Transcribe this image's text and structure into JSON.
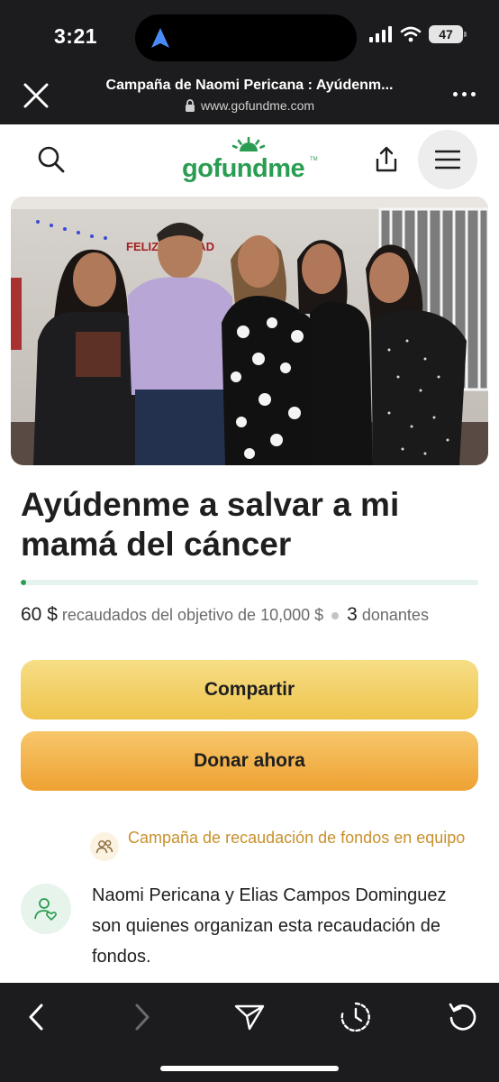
{
  "status_bar": {
    "time": "3:21",
    "battery": "47"
  },
  "browser": {
    "page_title": "Campaña de Naomi Pericana : Ayúdenm...",
    "url": "www.gofundme.com"
  },
  "site": {
    "logo_text": "gofundme",
    "logo_tm": "TM"
  },
  "campaign": {
    "title": "Ayúdenme a salvar a mi mamá del cáncer",
    "raised_amount": "60 $",
    "raised_label": "recaudados del objetivo de",
    "goal": "10,000 $",
    "donors_count": "3",
    "donors_label": "donantes",
    "progress_percent": 0.6,
    "banner_text": "FELIZ NAVIDAD"
  },
  "actions": {
    "share_label": "Compartir",
    "donate_label": "Donar ahora"
  },
  "organizer": {
    "team_label": "Campaña de recaudación de fondos en equipo",
    "description": "Naomi Pericana y Elias Campos Dominguez son quienes organizan esta recaudación de fondos."
  },
  "colors": {
    "brand_green": "#2a9d52",
    "share_button": "#f3d46a",
    "donate_button": "#f0ad42",
    "team_text": "#c8902b",
    "chrome": "#1c1c1e"
  },
  "icons": {
    "close": "close-icon",
    "more": "more-icon",
    "search": "search-icon",
    "share": "share-icon",
    "menu": "menu-icon",
    "back": "back-icon",
    "forward": "forward-icon",
    "send": "send-icon",
    "timer": "timer-icon",
    "reload": "reload-icon",
    "team": "team-icon",
    "organizer": "organizer-icon"
  }
}
